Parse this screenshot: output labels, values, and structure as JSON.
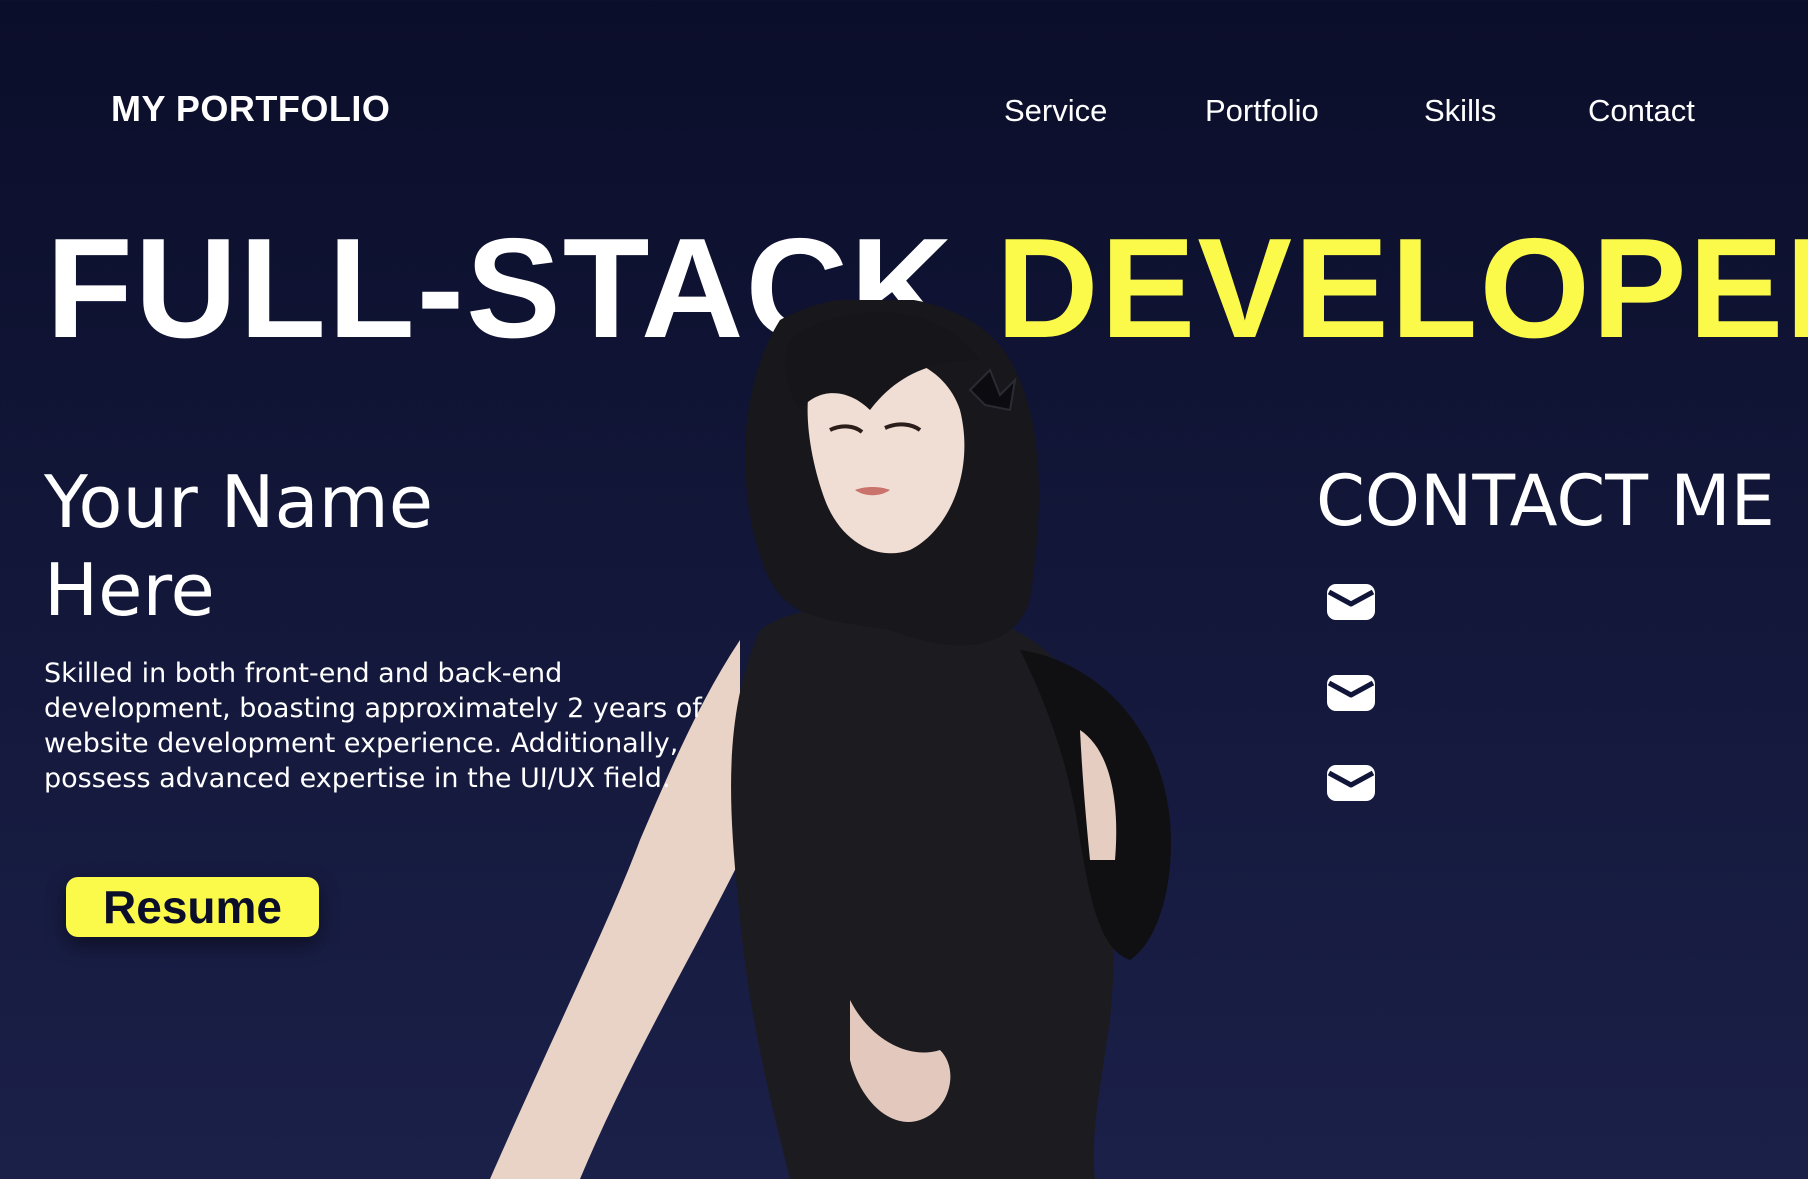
{
  "header": {
    "logo": "MY PORTFOLIO",
    "nav": [
      "Service",
      "Portfolio",
      "Skills",
      "Contact"
    ]
  },
  "hero": {
    "title_part1": "FULL-STACK ",
    "title_part2": "DEVELOPER",
    "name_line1": "Your Name",
    "name_line2": "Here",
    "bio": "Skilled in both front-end and back-end development, boasting approximately 2 years of website development experience. Additionally, possess advanced expertise in the UI/UX field.",
    "resume_label": "Resume"
  },
  "contact": {
    "title": "CONTACT ME",
    "icons": [
      "mail-icon",
      "mail-icon",
      "mail-icon"
    ]
  },
  "colors": {
    "background": "#0b0e2a",
    "accent": "#fbf94a",
    "text": "#ffffff"
  }
}
